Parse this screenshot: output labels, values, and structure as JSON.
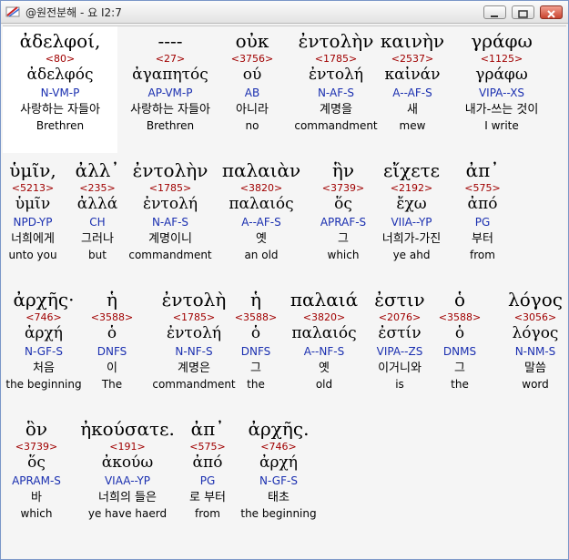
{
  "window": {
    "title": "@원전분해 - 요 I2:7"
  },
  "rows": [
    {
      "words": [
        {
          "greek": "ἀδελφοί,",
          "strong": "<80>",
          "lemma": "ἀδελφός",
          "morph": "N-VM-P",
          "korean": "사랑하는 자들아",
          "english": "Brethren"
        },
        {
          "greek": "----",
          "strong": "<27>",
          "lemma": "ἀγαπητός",
          "morph": "AP-VM-P",
          "korean": "사랑하는 자들아",
          "english": "Brethren"
        },
        {
          "greek": "οὐκ",
          "strong": "<3756>",
          "lemma": "ού",
          "morph": "AB",
          "korean": "아니라",
          "english": "no"
        },
        {
          "greek": "ἐντολὴν",
          "strong": "<1785>",
          "lemma": "ἐντολή",
          "morph": "N-AF-S",
          "korean": "계명을",
          "english": "commandment"
        },
        {
          "greek": "καινὴν",
          "strong": "<2537>",
          "lemma": "καἰνάν",
          "morph": "A--AF-S",
          "korean": "새",
          "english": "mew"
        },
        {
          "greek": "γράφω",
          "strong": "<1125>",
          "lemma": "γράφω",
          "morph": "VIPA--XS",
          "korean": "내가-쓰는 것이",
          "english": "I write"
        }
      ]
    },
    {
      "words": [
        {
          "greek": "ὑμῖν,",
          "strong": "<5213>",
          "lemma": "ὑμῖν",
          "morph": "NPD-YP",
          "korean": "너희에게",
          "english": "unto you"
        },
        {
          "greek": "ἀλλ᾽",
          "strong": "<235>",
          "lemma": "ἀλλά",
          "morph": "CH",
          "korean": "그러나",
          "english": "but"
        },
        {
          "greek": "ἐντολὴν",
          "strong": "<1785>",
          "lemma": "ἐντολή",
          "morph": "N-AF-S",
          "korean": "계명이니",
          "english": "commandment"
        },
        {
          "greek": "παλαιὰν",
          "strong": "<3820>",
          "lemma": "παλαιός",
          "morph": "A--AF-S",
          "korean": "옛",
          "english": "an old"
        },
        {
          "greek": "ἣν",
          "strong": "<3739>",
          "lemma": "ὅς",
          "morph": "APRAF-S",
          "korean": "그",
          "english": "which"
        },
        {
          "greek": "εἴχετε",
          "strong": "<2192>",
          "lemma": "ἔχω",
          "morph": "VIIA--YP",
          "korean": "너희가-가진",
          "english": "ye ahd"
        },
        {
          "greek": "ἀπ᾽",
          "strong": "<575>",
          "lemma": "ἀπό",
          "morph": "PG",
          "korean": "부터",
          "english": "from"
        }
      ]
    },
    {
      "words": [
        {
          "greek": "ἀρχῆς·",
          "strong": "<746>",
          "lemma": "ἀρχή",
          "morph": "N-GF-S",
          "korean": "처음",
          "english": "the beginning"
        },
        {
          "greek": "ἡ",
          "strong": "<3588>",
          "lemma": "ὁ",
          "morph": "DNFS",
          "korean": "이",
          "english": "The"
        },
        {
          "greek": "ἐντολὴ",
          "strong": "<1785>",
          "lemma": "ἐντολή",
          "morph": "N-NF-S",
          "korean": "계명은",
          "english": "commandment"
        },
        {
          "greek": "ἡ",
          "strong": "<3588>",
          "lemma": "ὁ",
          "morph": "DNFS",
          "korean": "그",
          "english": "the"
        },
        {
          "greek": "παλαιά",
          "strong": "<3820>",
          "lemma": "παλαιός",
          "morph": "A--NF-S",
          "korean": "옛",
          "english": "old"
        },
        {
          "greek": "ἐστιν",
          "strong": "<2076>",
          "lemma": "ἐστίν",
          "morph": "VIPA--ZS",
          "korean": "이거니와",
          "english": "is"
        },
        {
          "greek": "ὁ",
          "strong": "<3588>",
          "lemma": "ὁ",
          "morph": "DNMS",
          "korean": "그",
          "english": "the"
        },
        {
          "greek": "λόγος",
          "strong": "<3056>",
          "lemma": "λόγος",
          "morph": "N-NM-S",
          "korean": "말씀",
          "english": "word"
        }
      ]
    },
    {
      "words": [
        {
          "greek": "ὃν",
          "strong": "<3739>",
          "lemma": "ὅς",
          "morph": "APRAM-S",
          "korean": "바",
          "english": "which"
        },
        {
          "greek": "ἠκούσατε.",
          "strong": "<191>",
          "lemma": "ἀκούω",
          "morph": "VIAA--YP",
          "korean": "너희의 들은",
          "english": "ye have haerd"
        },
        {
          "greek": "ἀπ᾽",
          "strong": "<575>",
          "lemma": "ἀπό",
          "morph": "PG",
          "korean": "로 부터",
          "english": "from"
        },
        {
          "greek": "ἀρχῆς.",
          "strong": "<746>",
          "lemma": "ἀρχή",
          "morph": "N-GF-S",
          "korean": "태초",
          "english": "the beginning"
        }
      ]
    }
  ]
}
